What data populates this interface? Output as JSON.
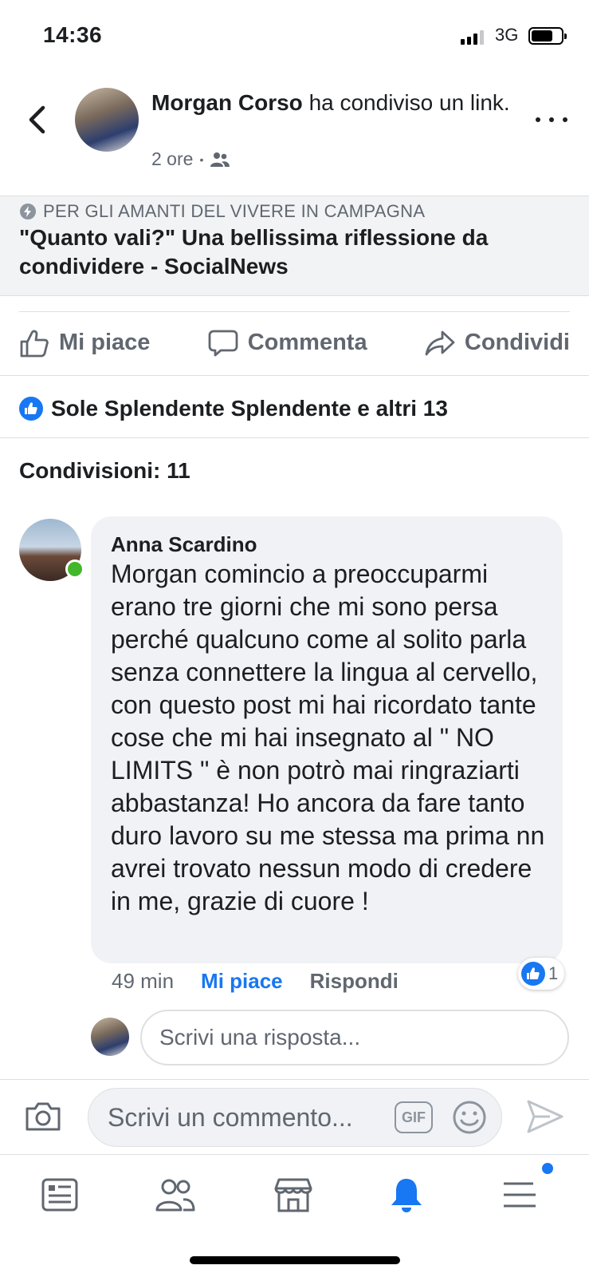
{
  "status_bar": {
    "time": "14:36",
    "network": "3G",
    "battery_level": 0.72
  },
  "header": {
    "author": "Morgan Corso",
    "action": "ha condiviso un link.",
    "time": "2 ore",
    "separator": "•",
    "audience_icon": "friends-icon"
  },
  "link": {
    "source": "PER GLI AMANTI DEL VIVERE IN CAMPAGNA",
    "title": "\"Quanto vali?\" Una bellissima riflessione da condividere - SocialNews"
  },
  "actions": {
    "like": "Mi piace",
    "comment": "Commenta",
    "share": "Condividi"
  },
  "reactions": {
    "summary": "Sole Splendente Splendente e altri 13"
  },
  "shares": {
    "label": "Condivisioni: 11"
  },
  "comment": {
    "author": "Anna Scardino",
    "text": "Morgan comincio a preoccuparmi erano tre giorni che mi sono persa perché qualcuno come al solito parla senza connettere la lingua al cervello, con questo post mi hai ricordato tante cose che mi hai insegnato al \" NO LIMITS \" è non potrò mai ringraziarti abbastanza! Ho ancora da fare tanto duro lavoro su me stessa ma prima nn avrei trovato nessun modo di credere in me, grazie di cuore !",
    "time": "49 min",
    "like_label": "Mi piace",
    "reply_label": "Rispondi",
    "reaction_count": "1"
  },
  "reply_box": {
    "placeholder": "Scrivi una risposta..."
  },
  "composer": {
    "placeholder": "Scrivi un commento...",
    "gif_label": "GIF"
  },
  "tabs": [
    "news-feed-icon",
    "friends-icon",
    "marketplace-icon",
    "notifications-icon",
    "menu-icon"
  ],
  "colors": {
    "accent": "#1877f2",
    "online": "#42b72a",
    "muted": "#606770"
  }
}
